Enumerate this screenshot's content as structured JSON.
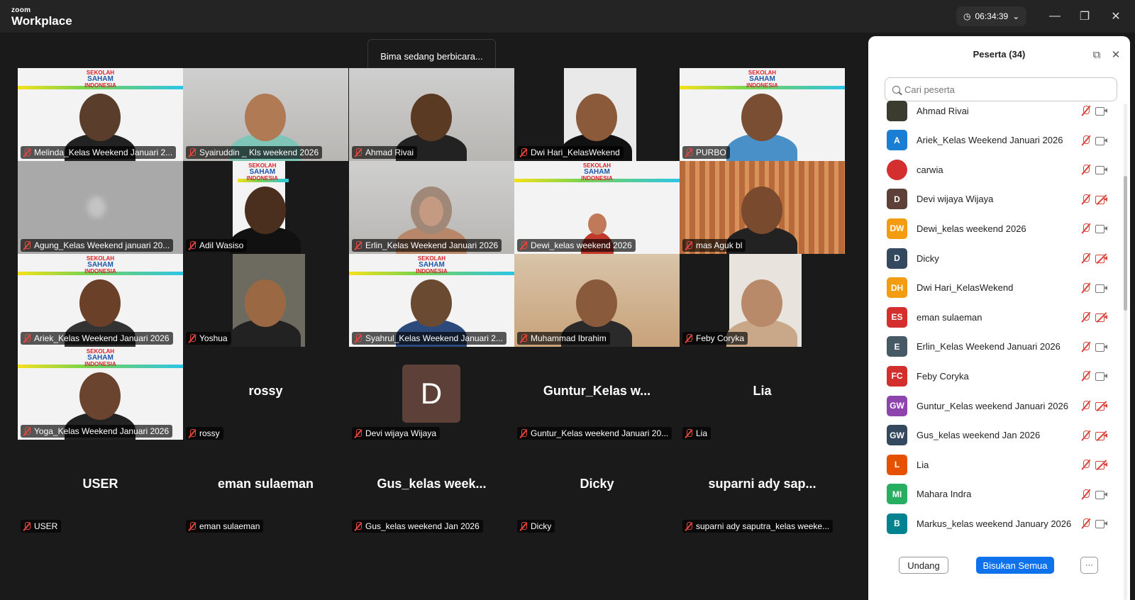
{
  "app": {
    "brand_small": "zoom",
    "brand_big": "Workplace",
    "timer": "06:34:39"
  },
  "window_controls": {
    "minimize": "—",
    "restore": "❐",
    "close": "✕"
  },
  "speaking_toast": "Bima sedang berbicara...",
  "logo": {
    "line1": "SEKOLAH",
    "line2": "SAHAM",
    "line3": "INDONESIA"
  },
  "tiles": [
    {
      "name": "Melinda_Kelas Weekend Januari 2..."
    },
    {
      "name": "Syairuddin _ Kls weekend 2026"
    },
    {
      "name": "Ahmad Rivai"
    },
    {
      "name": "Dwi Hari_KelasWekend"
    },
    {
      "name": "PURBO"
    },
    {
      "name": "Agung_Kelas Weekend januari 20..."
    },
    {
      "name": "Adil Wasiso"
    },
    {
      "name": "Erlin_Kelas Weekend Januari 2026"
    },
    {
      "name": "Dewi_kelas weekend 2026"
    },
    {
      "name": "mas Aguk bl"
    },
    {
      "name": "Ariek_Kelas Weekend Januari 2026"
    },
    {
      "name": "Yoshua"
    },
    {
      "name": "Syahrul_Kelas Weekend Januari 2..."
    },
    {
      "name": "Muhammad Ibrahim"
    },
    {
      "name": "Feby Coryka"
    },
    {
      "name": "Yoga_Kelas Weekend Januari 2026"
    },
    {
      "name": "rossy",
      "big": "rossy"
    },
    {
      "name": "Devi wijaya Wijaya",
      "avatar": "D"
    },
    {
      "name": "Guntur_Kelas weekend Januari 20...",
      "big": "Guntur_Kelas w..."
    },
    {
      "name": "Lia",
      "big": "Lia"
    },
    {
      "name": "USER",
      "big": "USER"
    },
    {
      "name": "eman sulaeman",
      "big": "eman sulaeman"
    },
    {
      "name": "Gus_kelas weekend Jan 2026",
      "big": "Gus_kelas week..."
    },
    {
      "name": "Dicky",
      "big": "Dicky"
    },
    {
      "name": "suparni ady saputra_kelas weeke...",
      "big": "suparni ady sap..."
    }
  ],
  "panel": {
    "title": "Peserta (34)",
    "search_placeholder": "Cari peserta",
    "participants": [
      {
        "initials": "",
        "name": "Ahmad Rivai",
        "color": "#3b3b2f",
        "cam_off": false
      },
      {
        "initials": "A",
        "name": "Ariek_Kelas Weekend Januari 2026",
        "color": "#1a7fd4",
        "cam_off": false
      },
      {
        "initials": "",
        "name": "carwia",
        "color": "#d32f2f",
        "cam_off": false
      },
      {
        "initials": "D",
        "name": "Devi wijaya Wijaya",
        "color": "#5d4037",
        "cam_off": true
      },
      {
        "initials": "DW",
        "name": "Dewi_kelas weekend 2026",
        "color": "#f39c12",
        "cam_off": false
      },
      {
        "initials": "D",
        "name": "Dicky",
        "color": "#34495e",
        "cam_off": true
      },
      {
        "initials": "DH",
        "name": "Dwi Hari_KelasWekend",
        "color": "#f39c12",
        "cam_off": false
      },
      {
        "initials": "ES",
        "name": "eman sulaeman",
        "color": "#d32f2f",
        "cam_off": true
      },
      {
        "initials": "E",
        "name": "Erlin_Kelas Weekend Januari 2026",
        "color": "#455a64",
        "cam_off": false
      },
      {
        "initials": "FC",
        "name": "Feby Coryka",
        "color": "#d32f2f",
        "cam_off": false
      },
      {
        "initials": "GW",
        "name": "Guntur_Kelas weekend Januari 2026",
        "color": "#8e44ad",
        "cam_off": true
      },
      {
        "initials": "GW",
        "name": "Gus_kelas weekend Jan 2026",
        "color": "#34495e",
        "cam_off": true
      },
      {
        "initials": "L",
        "name": "Lia",
        "color": "#e65100",
        "cam_off": true
      },
      {
        "initials": "MI",
        "name": "Mahara Indra",
        "color": "#27ae60",
        "cam_off": false
      },
      {
        "initials": "B",
        "name": "Markus_kelas weekend January 2026",
        "color": "#00838f",
        "cam_off": false
      }
    ],
    "invite_label": "Undang",
    "mute_all_label": "Bisukan Semua",
    "more_label": "···"
  }
}
